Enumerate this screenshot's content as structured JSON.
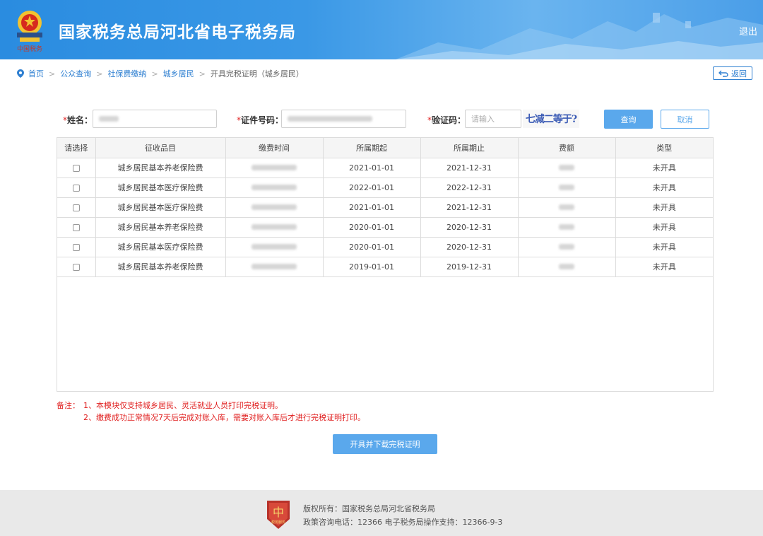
{
  "header": {
    "site_title": "国家税务总局河北省电子税务局",
    "logout_label": "退出",
    "emblem_caption": "中国税务"
  },
  "breadcrumb": {
    "items": [
      "首页",
      "公众查询",
      "社保费缴纳",
      "城乡居民"
    ],
    "current": "开具完税证明（城乡居民）",
    "separator": ">",
    "back_label": "返回"
  },
  "form": {
    "name_label": "姓名：",
    "id_label": "证件号码：",
    "captcha_label": "验证码：",
    "required_mark": "*",
    "captcha_placeholder": "请输入",
    "captcha_text": "七减二等于?",
    "query_label": "查询",
    "cancel_label": "取消"
  },
  "table": {
    "headers": [
      "请选择",
      "征收品目",
      "缴费时间",
      "所属期起",
      "所属期止",
      "费额",
      "类型"
    ],
    "rows": [
      {
        "item": "城乡居民基本养老保险费",
        "start": "2021-01-01",
        "end": "2021-12-31",
        "type": "未开具"
      },
      {
        "item": "城乡居民基本医疗保险费",
        "start": "2022-01-01",
        "end": "2022-12-31",
        "type": "未开具"
      },
      {
        "item": "城乡居民基本医疗保险费",
        "start": "2021-01-01",
        "end": "2021-12-31",
        "type": "未开具"
      },
      {
        "item": "城乡居民基本养老保险费",
        "start": "2020-01-01",
        "end": "2020-12-31",
        "type": "未开具"
      },
      {
        "item": "城乡居民基本医疗保险费",
        "start": "2020-01-01",
        "end": "2020-12-31",
        "type": "未开具"
      },
      {
        "item": "城乡居民基本养老保险费",
        "start": "2019-01-01",
        "end": "2019-12-31",
        "type": "未开具"
      }
    ]
  },
  "notes": {
    "label": "备注：",
    "line1": "1、本模块仅支持城乡居民、灵活就业人员打印完税证明。",
    "line2": "2、缴费成功正常情况7天后完成对账入库，需要对账入库后才进行完税证明打印。"
  },
  "download_label": "开具并下载完税证明",
  "footer": {
    "copyright": "版权所有：国家税务总局河北省税务局",
    "hotline": "政策咨询电话：12366  电子税务局操作支持：12366-9-3",
    "logo_caption": "税务服务"
  },
  "colors": {
    "header_blue": "#2a8de2",
    "link_blue": "#2e7fd1",
    "button_blue": "#5aa8ec",
    "note_red": "#e02020"
  }
}
